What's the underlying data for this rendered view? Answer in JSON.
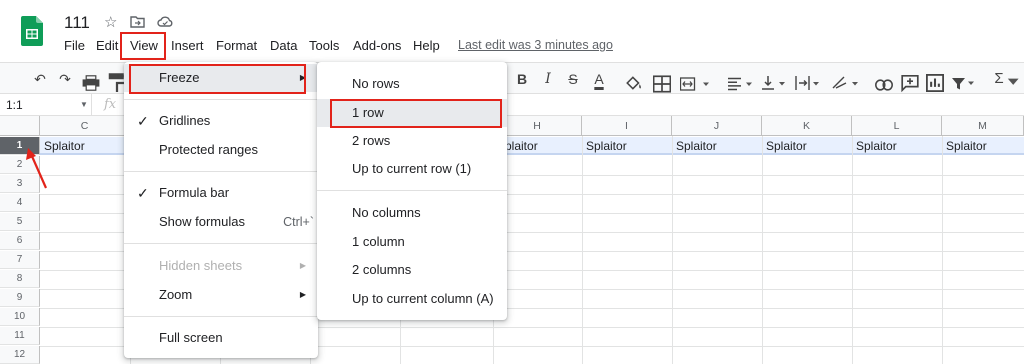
{
  "doc": {
    "title": "111",
    "last_edit": "Last edit was 3 minutes ago"
  },
  "icons": {
    "star": "star-icon",
    "move": "move-to-folder-icon",
    "cloud": "cloud-status-icon"
  },
  "menubar": [
    "File",
    "Edit",
    "View",
    "Insert",
    "Format",
    "Data",
    "Tools",
    "Add-ons",
    "Help"
  ],
  "toolbar": {
    "bold": "B",
    "italic": "I",
    "strike": "S",
    "text_color": "A",
    "sum": "Σ"
  },
  "formula_bar": {
    "namebox": "1:1",
    "fx": "fx"
  },
  "grid": {
    "columns": [
      "C",
      "H",
      "I",
      "J",
      "K",
      "L",
      "M"
    ],
    "rows": [
      "1",
      "2",
      "3",
      "4",
      "5",
      "6",
      "7",
      "8",
      "9",
      "10",
      "11",
      "12"
    ],
    "row1_values": [
      "Splaitor",
      "Splaitor",
      "Splaitor",
      "Splaitor",
      "Splaitor",
      "Splaitor",
      "Splaitor"
    ]
  },
  "view_menu": {
    "freeze": "Freeze",
    "gridlines": "Gridlines",
    "protected_ranges": "Protected ranges",
    "formula_bar": "Formula bar",
    "show_formulas": "Show formulas",
    "show_formulas_shortcut": "Ctrl+`",
    "hidden_sheets": "Hidden sheets",
    "zoom": "Zoom",
    "full_screen": "Full screen"
  },
  "freeze_menu": {
    "no_rows": "No rows",
    "one_row": "1 row",
    "two_rows": "2 rows",
    "up_to_row": "Up to current row (1)",
    "no_columns": "No columns",
    "one_column": "1 column",
    "two_columns": "2 columns",
    "up_to_column": "Up to current column (A)"
  },
  "colors": {
    "accent": "#1a73e8",
    "annotation": "#e2231a",
    "sheets_green": "#0f9d58",
    "row_band": "#e8f0fe"
  }
}
